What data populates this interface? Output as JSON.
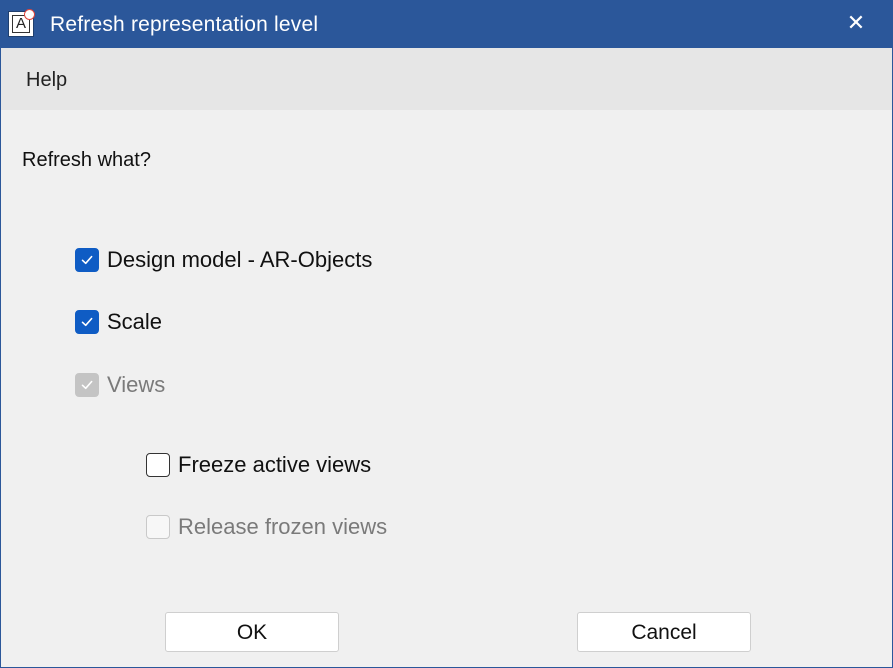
{
  "window": {
    "title": "Refresh representation level",
    "app_icon_letter": "A",
    "close_glyph": "✕",
    "colors": {
      "titlebar": "#2b579a",
      "menubar": "#e6e6e6",
      "body": "#f0f0f0",
      "checkbox_checked": "#0f5cc4"
    }
  },
  "menu": {
    "help_label": "Help"
  },
  "dialog": {
    "prompt": "Refresh what?",
    "options": [
      {
        "label": "Design model - AR-Objects",
        "checked": true,
        "enabled": true
      },
      {
        "label": "Scale",
        "checked": true,
        "enabled": true
      },
      {
        "label": "Views",
        "checked": true,
        "enabled": false
      },
      {
        "label": "Freeze active views",
        "checked": false,
        "enabled": true
      },
      {
        "label": "Release frozen views",
        "checked": false,
        "enabled": false
      }
    ]
  },
  "buttons": {
    "ok_label": "OK",
    "cancel_label": "Cancel"
  }
}
